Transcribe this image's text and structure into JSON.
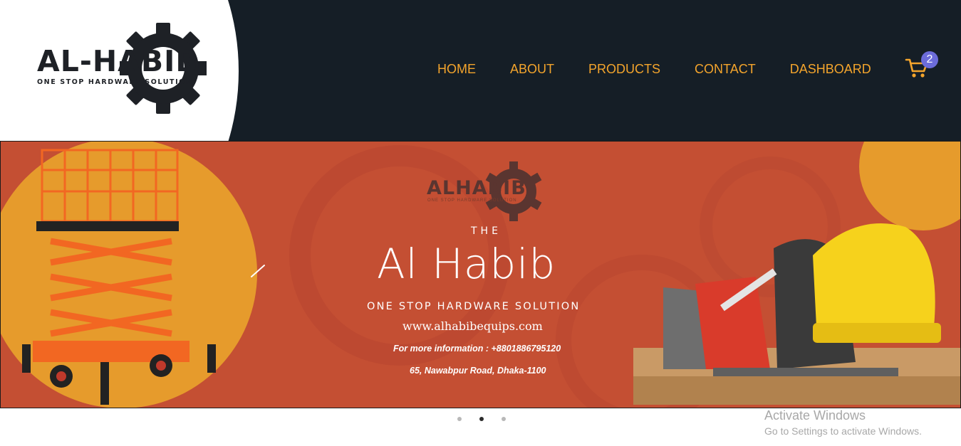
{
  "logo": {
    "word": "AL-HABIB",
    "tagline": "ONE STOP HARDWARE SOLUTION",
    "icon": "gear-icon"
  },
  "nav": {
    "items": [
      {
        "label": "HOME"
      },
      {
        "label": "ABOUT"
      },
      {
        "label": "PRODUCTS"
      },
      {
        "label": "CONTACT"
      },
      {
        "label": "DASHBOARD"
      }
    ]
  },
  "cart": {
    "icon": "cart-icon",
    "count": "2"
  },
  "banner": {
    "logo_word": "ALHABIB",
    "logo_tag": "ONE STOP HARDWARE SOLUTION",
    "the": "THE",
    "title": "Al Habib",
    "subtitle": "ONE STOP HARDWARE SOLUTION",
    "url": "www.alhabibequips.com",
    "info": "For more information : +8801886795120",
    "address": "65, Nawabpur Road, Dhaka-1100",
    "prev_icon": "chevron-left-icon"
  },
  "carousel": {
    "active_index": 1,
    "slides": 3
  },
  "watermark": {
    "title": "Activate Windows",
    "subtitle": "Go to Settings to activate Windows."
  },
  "colors": {
    "header_bg": "#151e26",
    "nav_text": "#f3a42c",
    "banner_bg": "#c44f33",
    "banner_accent": "#e69b2c",
    "badge": "#6c6cd9"
  }
}
